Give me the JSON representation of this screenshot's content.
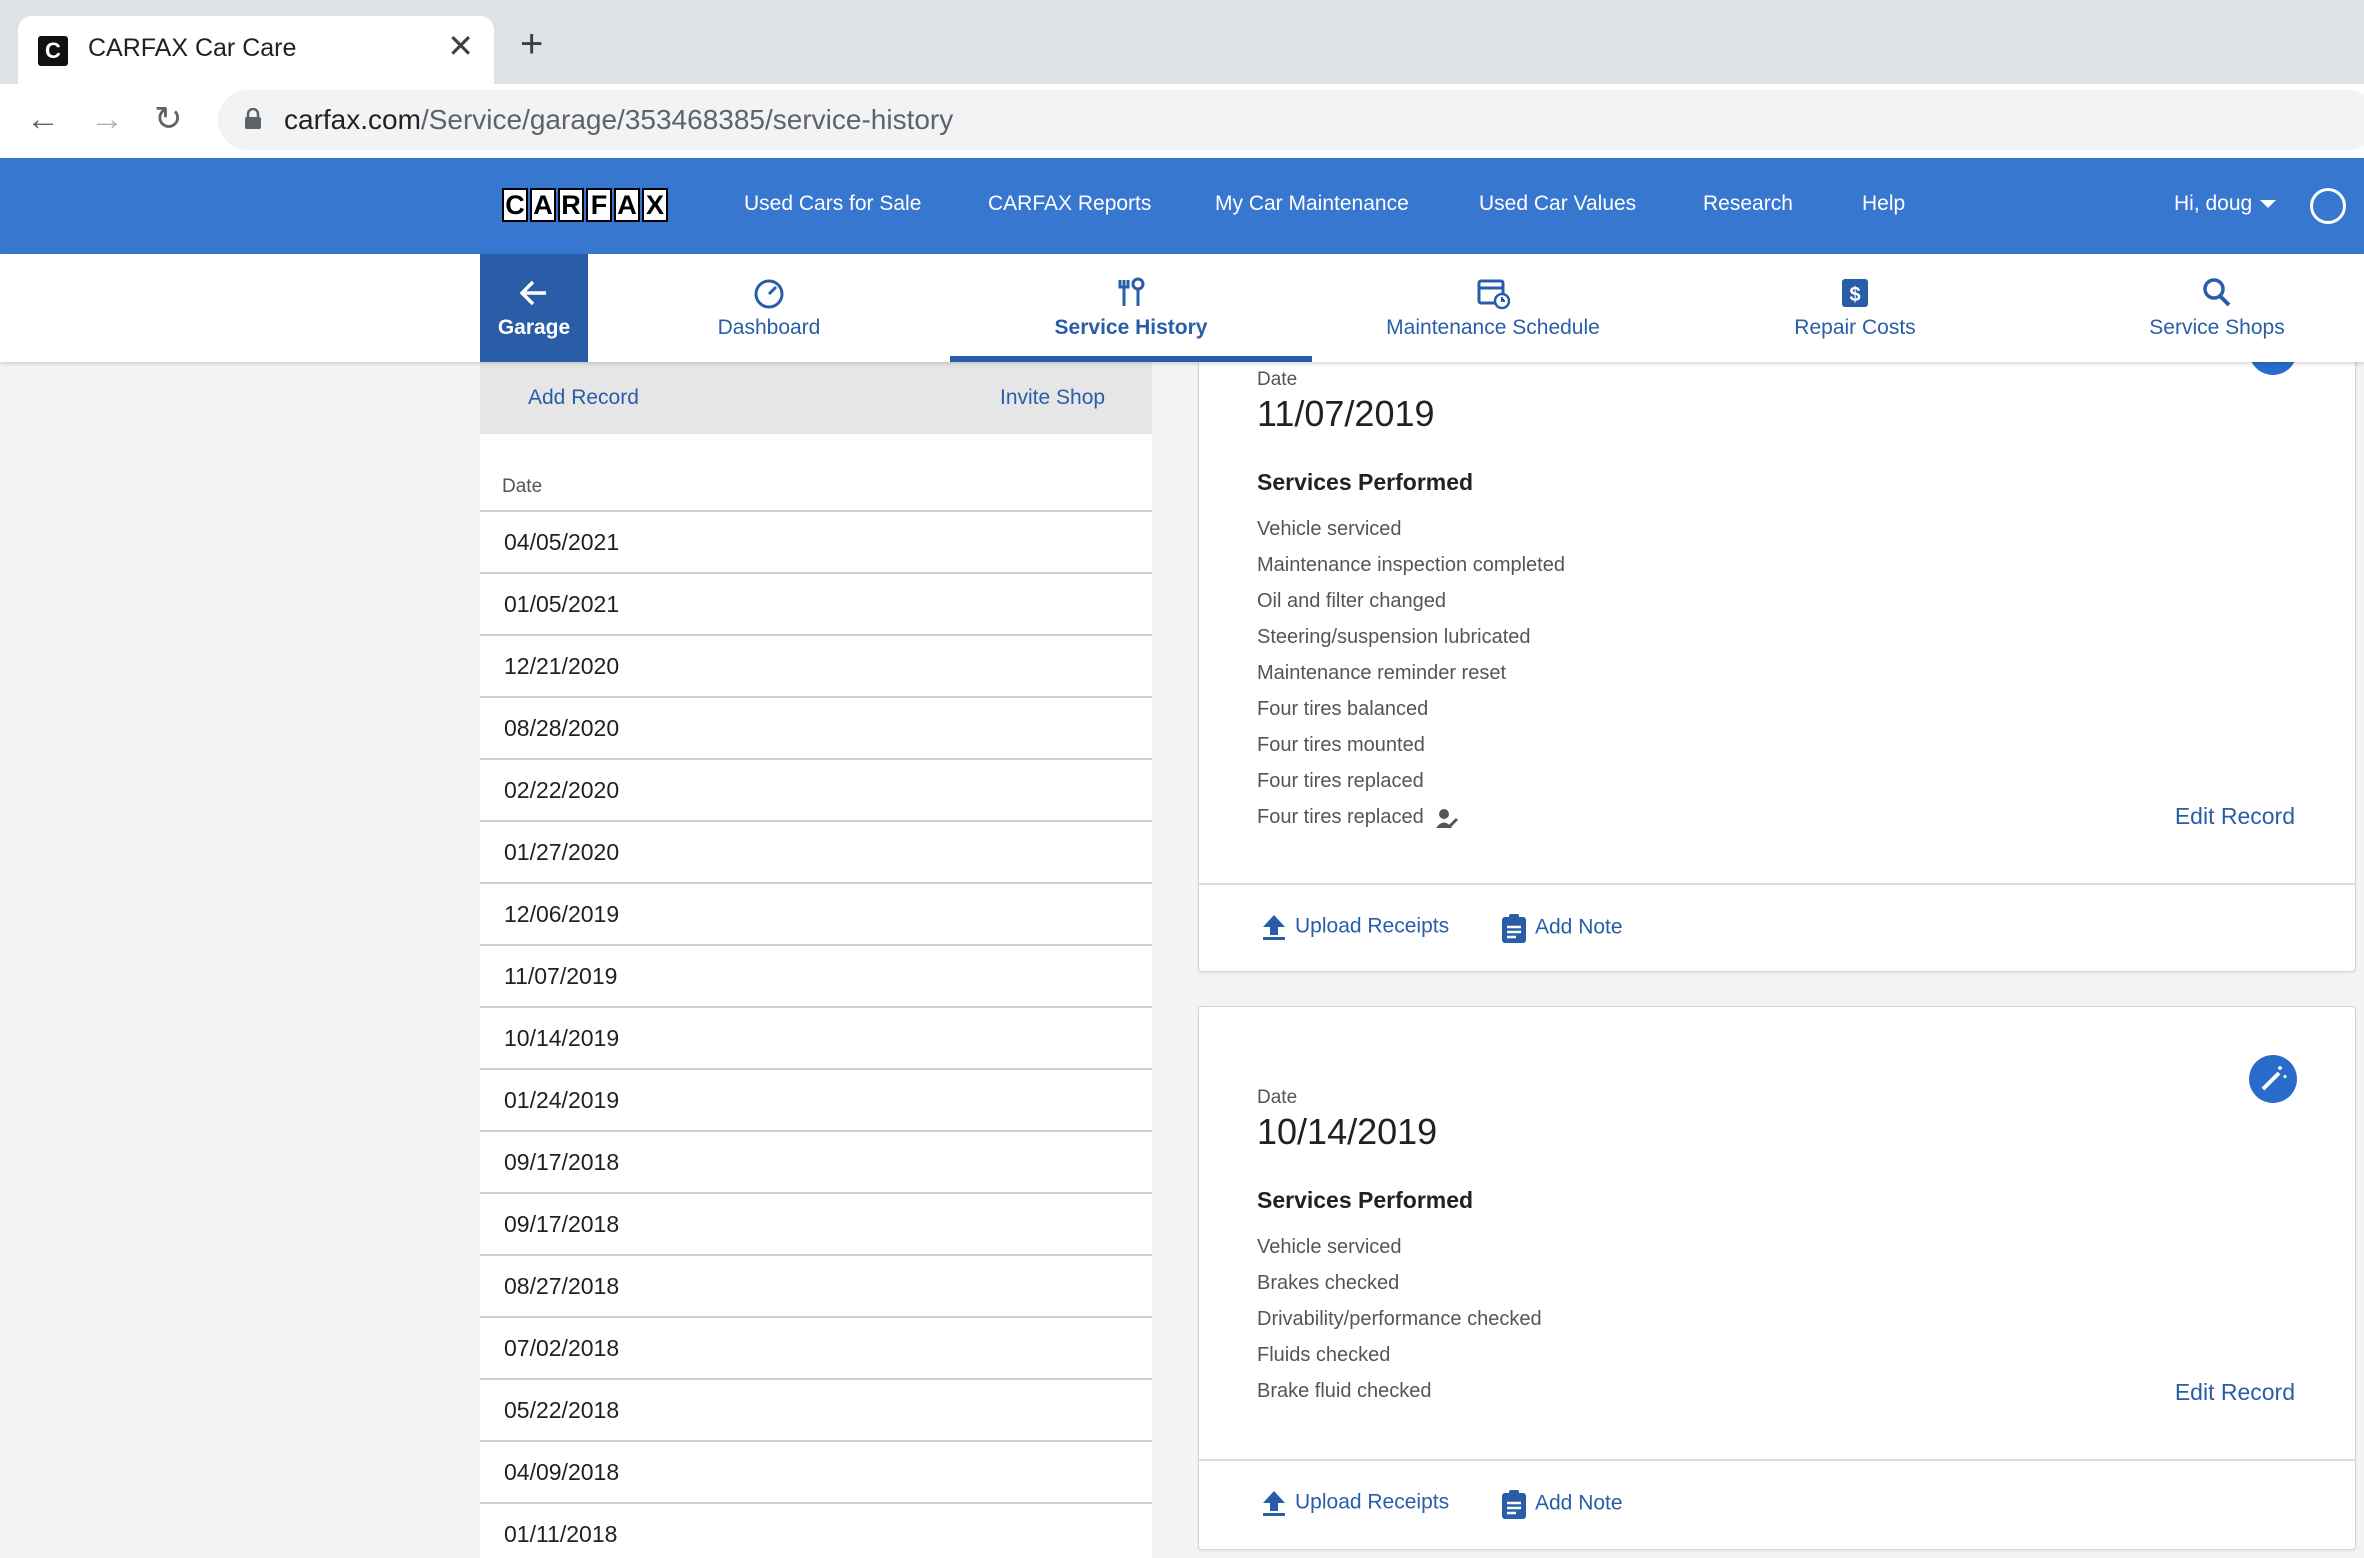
{
  "browser": {
    "tab_title": "CARFAX Car Care",
    "favicon_letter": "C",
    "url_host": "carfax.com",
    "url_path": "/Service/garage/353468385/service-history"
  },
  "header": {
    "logo_letters": [
      "C",
      "A",
      "R",
      "F",
      "A",
      "X"
    ],
    "nav": [
      "Used Cars for Sale",
      "CARFAX Reports",
      "My Car Maintenance",
      "Used Car Values",
      "Research",
      "Help"
    ],
    "user_greeting": "Hi, doug"
  },
  "subnav": {
    "garage_label": "Garage",
    "tabs": [
      "Dashboard",
      "Service History",
      "Maintenance Schedule",
      "Repair Costs",
      "Service Shops"
    ],
    "active": "Service History"
  },
  "left_panel": {
    "add_record": "Add Record",
    "invite_shop": "Invite Shop",
    "date_header": "Date",
    "dates": [
      "04/05/2021",
      "01/05/2021",
      "12/21/2020",
      "08/28/2020",
      "02/22/2020",
      "01/27/2020",
      "12/06/2019",
      "11/07/2019",
      "10/14/2019",
      "01/24/2019",
      "09/17/2018",
      "09/17/2018",
      "08/27/2018",
      "07/02/2018",
      "05/22/2018",
      "04/09/2018",
      "01/11/2018"
    ]
  },
  "records": [
    {
      "date_label": "Date",
      "date": "11/07/2019",
      "services_title": "Services Performed",
      "services": [
        "Vehicle serviced",
        "Maintenance inspection completed",
        "Oil and filter changed",
        "Steering/suspension lubricated",
        "Maintenance reminder reset",
        "Four tires balanced",
        "Four tires mounted",
        "Four tires replaced",
        "Four tires replaced"
      ],
      "edit_label": "Edit Record",
      "upload_label": "Upload Receipts",
      "note_label": "Add Note"
    },
    {
      "date_label": "Date",
      "date": "10/14/2019",
      "services_title": "Services Performed",
      "services": [
        "Vehicle serviced",
        "Brakes checked",
        "Drivability/performance checked",
        "Fluids checked",
        "Brake fluid checked"
      ],
      "edit_label": "Edit Record",
      "upload_label": "Upload Receipts",
      "note_label": "Add Note"
    }
  ],
  "colors": {
    "brand_blue": "#3777cf",
    "link_blue": "#2a5da8"
  }
}
